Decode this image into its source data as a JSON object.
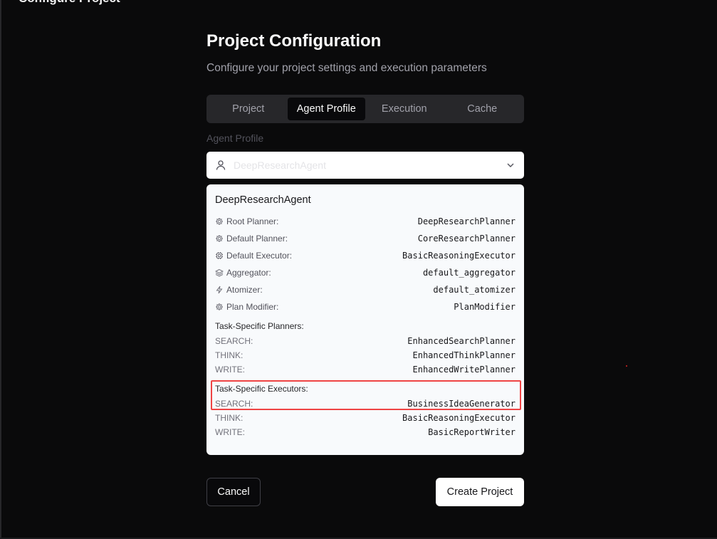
{
  "window": {
    "title": "Configure Project"
  },
  "page": {
    "heading": "Project Configuration",
    "subheading": "Configure your project settings and execution parameters"
  },
  "tabs": [
    {
      "label": "Project",
      "active": false
    },
    {
      "label": "Agent Profile",
      "active": true
    },
    {
      "label": "Execution",
      "active": false
    },
    {
      "label": "Cache",
      "active": false
    }
  ],
  "agent_profile": {
    "label": "Agent Profile",
    "selected_value": "DeepResearchAgent",
    "icon": "user-icon",
    "dropdown_icon": "chevron-down-icon"
  },
  "profile_card": {
    "name": "DeepResearchAgent",
    "components": [
      {
        "label": "Root Planner:",
        "value": "DeepResearchPlanner",
        "icon": "gear-icon"
      },
      {
        "label": "Default Planner:",
        "value": "CoreResearchPlanner",
        "icon": "gear-icon"
      },
      {
        "label": "Default Executor:",
        "value": "BasicReasoningExecutor",
        "icon": "cpu-icon"
      },
      {
        "label": "Aggregator:",
        "value": "default_aggregator",
        "icon": "layers-icon"
      },
      {
        "label": "Atomizer:",
        "value": "default_atomizer",
        "icon": "lightning-icon"
      },
      {
        "label": "Plan Modifier:",
        "value": "PlanModifier",
        "icon": "gear-icon"
      }
    ],
    "planners_title": "Task-Specific Planners:",
    "planners": [
      {
        "key": "SEARCH:",
        "value": "EnhancedSearchPlanner"
      },
      {
        "key": "THINK:",
        "value": "EnhancedThinkPlanner"
      },
      {
        "key": "WRITE:",
        "value": "EnhancedWritePlanner"
      }
    ],
    "executors_title": "Task-Specific Executors:",
    "executors": [
      {
        "key": "SEARCH:",
        "value": "BusinessIdeaGenerator"
      },
      {
        "key": "THINK:",
        "value": "BasicReasoningExecutor"
      },
      {
        "key": "WRITE:",
        "value": "BasicReportWriter"
      }
    ]
  },
  "actions": {
    "cancel": "Cancel",
    "create": "Create Project"
  },
  "colors": {
    "background": "#0a0a0b",
    "highlight": "#ef4444",
    "card": "#f8fafc"
  }
}
